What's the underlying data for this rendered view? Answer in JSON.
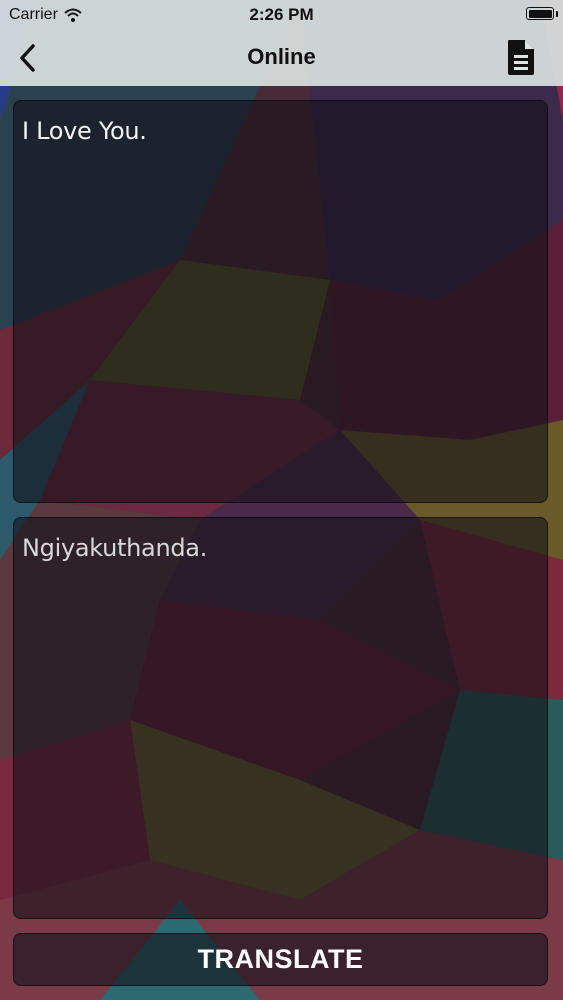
{
  "status_bar": {
    "carrier": "Carrier",
    "time": "2:26 PM"
  },
  "nav": {
    "title": "Online"
  },
  "source": {
    "text": "I Love You."
  },
  "result": {
    "text": "Ngiyakuthanda."
  },
  "actions": {
    "translate_label": "TRANSLATE"
  }
}
